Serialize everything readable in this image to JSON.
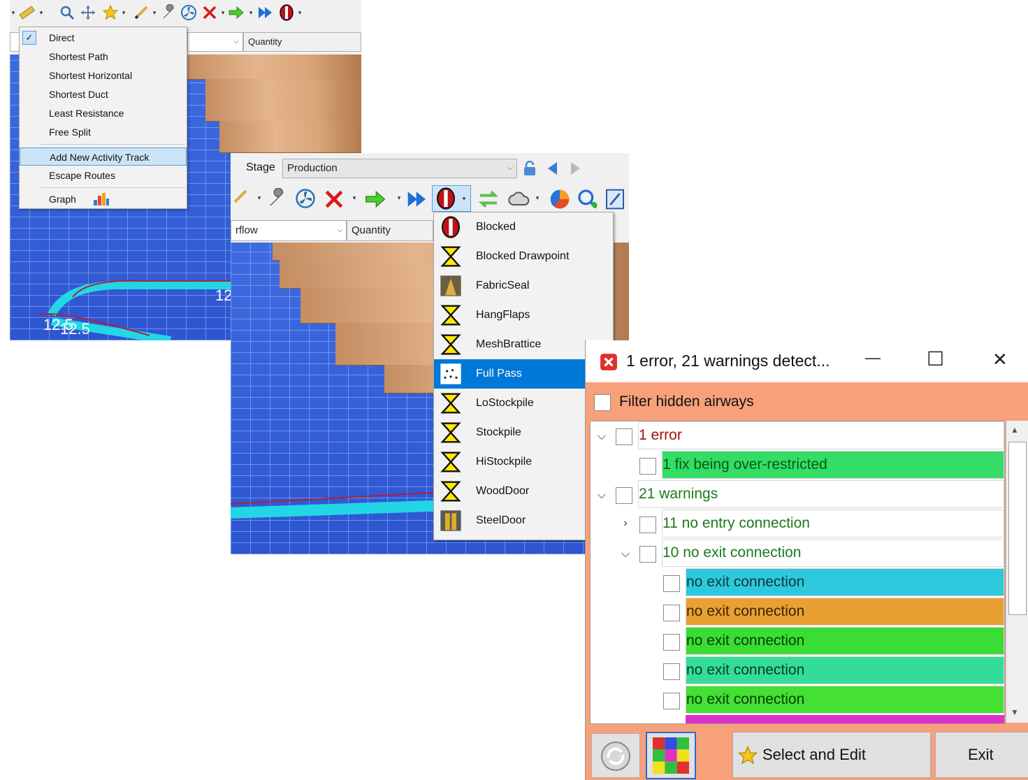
{
  "panel1": {
    "header_combo_label": "Quantity",
    "menu_items": [
      {
        "label": "Direct",
        "checked": true
      },
      {
        "label": "Shortest Path"
      },
      {
        "label": "Shortest Horizontal"
      },
      {
        "label": "Shortest Duct"
      },
      {
        "label": "Least Resistance"
      },
      {
        "label": "Free Split"
      },
      {
        "label": "Add New Activity Track",
        "highlighted": true
      },
      {
        "label": "Escape Routes"
      },
      {
        "label": "Graph"
      }
    ],
    "checkmark": "✓",
    "scene_labels": {
      "a": "12",
      "b": "12.5",
      "c": "12.5"
    }
  },
  "panel2": {
    "stage_label": "Stage",
    "stage_value": "Production",
    "combo_left": "rflow",
    "combo_right": "Quantity",
    "menu_items": [
      {
        "label": "Blocked",
        "icon": "blocked-icon"
      },
      {
        "label": "Blocked Drawpoint",
        "icon": "hourglass-icon"
      },
      {
        "label": "FabricSeal",
        "icon": "fabric-seal-icon"
      },
      {
        "label": "HangFlaps",
        "icon": "hourglass-icon"
      },
      {
        "label": "MeshBrattice",
        "icon": "hourglass-icon"
      },
      {
        "label": "Full Pass",
        "icon": "full-pass-icon",
        "selected": true
      },
      {
        "label": "LoStockpile",
        "icon": "hourglass-icon"
      },
      {
        "label": "Stockpile",
        "icon": "hourglass-icon"
      },
      {
        "label": "HiStockpile",
        "icon": "hourglass-icon"
      },
      {
        "label": "WoodDoor",
        "icon": "hourglass-icon"
      },
      {
        "label": "SteelDoor",
        "icon": "steel-door-icon"
      }
    ]
  },
  "panel3": {
    "window_title": "1 error, 21 warnings detect...",
    "filter_label": "Filter hidden airways",
    "tree_rows": [
      {
        "label": "1 error",
        "level": 0,
        "expander": "v",
        "color": "#ffffff",
        "text_color": "#a01010"
      },
      {
        "label": "1 fix being over-restricted",
        "level": 1,
        "expander": "",
        "color": "#33dd66",
        "text_color": "#0a5a14"
      },
      {
        "label": "21 warnings",
        "level": 0,
        "expander": "v",
        "color": "#ffffff",
        "text_color": "#1c7a1c"
      },
      {
        "label": "11 no entry connection",
        "level": 1,
        "expander": ">",
        "color": "#ffffff",
        "text_color": "#1c7a1c"
      },
      {
        "label": "10 no exit connection",
        "level": 1,
        "expander": "v",
        "color": "#ffffff",
        "text_color": "#1c7a1c"
      },
      {
        "label": "no exit connection",
        "level": 2,
        "expander": "",
        "color": "#2ec8dc",
        "text_color": "#0a3a3a"
      },
      {
        "label": "no exit connection",
        "level": 2,
        "expander": "",
        "color": "#e9a033",
        "text_color": "#3a2400"
      },
      {
        "label": "no exit connection",
        "level": 2,
        "expander": "",
        "color": "#39dd33",
        "text_color": "#0a3a0a"
      },
      {
        "label": "no exit connection",
        "level": 2,
        "expander": "",
        "color": "#33dd99",
        "text_color": "#0a3a2a"
      },
      {
        "label": "no exit connection",
        "level": 2,
        "expander": "",
        "color": "#44e033",
        "text_color": "#0a3a0a"
      }
    ],
    "select_edit_label": "Select and Edit",
    "exit_label": "Exit",
    "minimize_glyph": "—",
    "maximize_glyph": "☐",
    "close_glyph": "✕"
  }
}
